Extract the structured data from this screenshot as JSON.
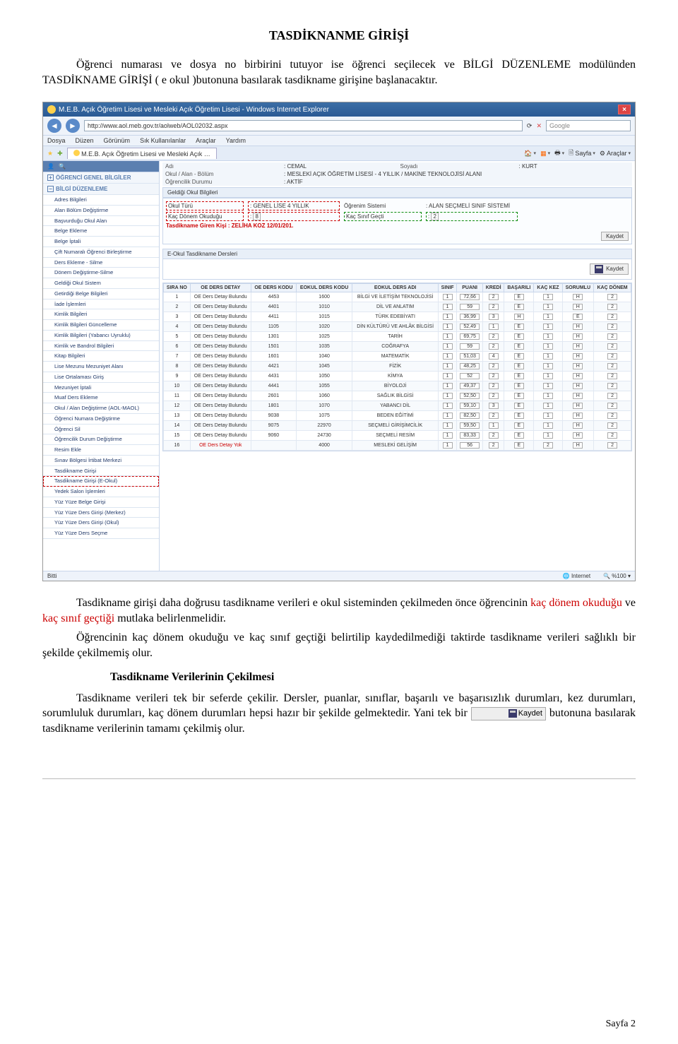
{
  "doc": {
    "title": "TASDİKNANME GİRİŞİ",
    "para1a": "Öğrenci numarası ve dosya no birbirini tutuyor ise öğrenci seçilecek ve BİLGİ DÜZENLEME modülünden TASDİKNAME GİRİŞİ ( e okul )butonuna basılarak tasdikname girişine başlanacaktır.",
    "para2a": "Tasdikname girişi daha doğrusu tasdikname verileri e okul sisteminden çekilmeden önce öğrencinin ",
    "para2b": "kaç dönem okuduğu",
    "para2c": " ve ",
    "para2d": "kaç sınıf geçtiği",
    "para2e": " mutlaka belirlenmelidir.",
    "para3": "Öğrencinin kaç dönem okuduğu ve kaç sınıf geçtiği belirtilip kaydedilmediği taktirde tasdikname verileri sağlıklı bir şekilde çekilmemiş olur.",
    "subheading": "Tasdikname Verilerinin Çekilmesi",
    "para4a": "Tasdikname verileri tek bir seferde çekilir. Dersler, puanlar, sınıflar, başarılı ve başarısızlık durumları, kez durumları, sorumluluk durumları, kaç dönem durumları hepsi hazır bir şekilde gelmektedir. Yani tek bir ",
    "para4b": "butonuna basılarak tasdikname verilerinin tamamı çekilmiş olur.",
    "kaydet": "Kaydet",
    "page": "Sayfa 2"
  },
  "ie": {
    "title": "M.E.B. Açık Öğretim Lisesi ve Mesleki Açık Öğretim Lisesi - Windows Internet Explorer",
    "url": "http://www.aol.meb.gov.tr/aolweb/AOL02032.aspx",
    "search": "Google",
    "menus": [
      "Dosya",
      "Düzen",
      "Görünüm",
      "Sık Kullanılanlar",
      "Araçlar",
      "Yardım"
    ],
    "tab": "M.E.B. Açık Öğretim Lisesi ve Mesleki Açık …",
    "tb": {
      "sayfa": "Sayfa",
      "araclar": "Araçlar"
    },
    "status_left": "Bitti",
    "status_net": "Internet",
    "status_zoom": "%100"
  },
  "sidebar": {
    "sections": [
      {
        "label": "ÖĞRENCİ GENEL BİLGİLER",
        "collapsed": true
      },
      {
        "label": "BİLGİ DÜZENLEME",
        "collapsed": false
      }
    ],
    "items": [
      "Adres Bilgileri",
      "Alan Bölüm Değiştirme",
      "Başvurduğu Okul Alan",
      "Belge Ekleme",
      "Belge İptali",
      "Çift Numaralı Öğrenci Birleştirme",
      "Ders Ekleme - Silme",
      "Dönem Değiştirme-Silme",
      "Geldiği Okul Sistem",
      "Getirdiği Belge Bilgileri",
      "İade İşlemleri",
      "Kimlik Bilgileri",
      "Kimlik Bilgileri Güncelleme",
      "Kimlik Bilgileri (Yabancı Uyruklu)",
      "Kimlik ve Bandrol Bilgileri",
      "Kitap Bilgileri",
      "Lise Mezunu Mezuniyet Alanı",
      "Lise Ortalaması Giriş",
      "Mezuniyet İptali",
      "Muaf Ders Ekleme",
      "Okul / Alan Değiştirme (AOL-MAOL)",
      "Öğrenci Numara Değiştirme",
      "Öğrenci Sil",
      "Öğrencilik Durum Değiştirme",
      "Resim Ekle",
      "Sınav Bölgesi İrtibat Merkezi",
      "Tasdikname Girişi",
      "Tasdikname Girişi (E-Okul)",
      "Yedek Salon İşlemleri",
      "Yüz Yüze Belge Girişi",
      "Yüz Yüze Ders Girişi (Merkez)",
      "Yüz Yüze Ders Girişi (Okul)",
      "Yüz Yüze Ders Seçme"
    ]
  },
  "main": {
    "info": {
      "adi_label": "Adı",
      "adi_value": ": CEMAL",
      "soyadi_label": "Soyadı",
      "soyadi_value": ": KURT",
      "okul_label": "Okul / Alan - Bölüm",
      "okul_value": ": MESLEKİ AÇIK ÖĞRETİM LİSESİ - 4 YILLIK / MAKİNE TEKNOLOJİSİ ALANI",
      "durum_label": "Öğrencilik Durumu",
      "durum_value": ": AKTİF"
    },
    "geldigi_title": "Geldiği Okul Bilgileri",
    "geldigi": {
      "okul_turu_label": "Okul Türü",
      "okul_turu_value": ": GENEL LİSE 4 YILLIK",
      "ogrenim_label": "Öğrenim Sistemi",
      "ogrenim_value": ": ALAN SEÇMELİ SINIF SİSTEMİ",
      "kac_donem_label": "Kaç Dönem Okuduğu",
      "kac_donem_value": "8",
      "kac_sinif_label": "Kaç Sınıf Geçti",
      "kac_sinif_value": "2",
      "giren_kisi": "Tasdikname Giren Kişi : ZELİHA KOZ 12/01/201.",
      "kaydet_btn": "Kaydet"
    },
    "eokul_title": "E-Okul Tasdikname Dersleri",
    "kaydet_btn2": "Kaydet",
    "headers": [
      "SIRA NO",
      "OE DERS DETAY",
      "OE DERS KODU",
      "EOKUL DERS KODU",
      "EOKUL DERS ADI",
      "SINIF",
      "PUANI",
      "KREDİ",
      "BAŞARILI",
      "KAÇ KEZ",
      "SORUMLU",
      "KAÇ DÖNEM"
    ],
    "rows": [
      {
        "no": "1",
        "detay": "OE Ders Detay Bulundu",
        "oekod": "4453",
        "ekod": "1600",
        "ad": "BİLGİ VE İLETİŞİM TEKNOLOJİSİ",
        "sinif": "1",
        "puan": "72,66",
        "kredi": "2",
        "bas": "E",
        "kez": "1",
        "sor": "H",
        "don": "2"
      },
      {
        "no": "2",
        "detay": "OE Ders Detay Bulundu",
        "oekod": "4401",
        "ekod": "1010",
        "ad": "DİL VE ANLATIM",
        "sinif": "1",
        "puan": "59",
        "kredi": "2",
        "bas": "E",
        "kez": "1",
        "sor": "H",
        "don": "2"
      },
      {
        "no": "3",
        "detay": "OE Ders Detay Bulundu",
        "oekod": "4411",
        "ekod": "1015",
        "ad": "TÜRK EDEBİYATI",
        "sinif": "1",
        "puan": "36,99",
        "kredi": "3",
        "bas": "H",
        "kez": "1",
        "sor": "E",
        "don": "2"
      },
      {
        "no": "4",
        "detay": "OE Ders Detay Bulundu",
        "oekod": "1105",
        "ekod": "1020",
        "ad": "DİN KÜLTÜRÜ VE AHLÂK BİLGİSİ",
        "sinif": "1",
        "puan": "52,49",
        "kredi": "1",
        "bas": "E",
        "kez": "1",
        "sor": "H",
        "don": "2"
      },
      {
        "no": "5",
        "detay": "OE Ders Detay Bulundu",
        "oekod": "1301",
        "ekod": "1025",
        "ad": "TARİH",
        "sinif": "1",
        "puan": "69,75",
        "kredi": "2",
        "bas": "E",
        "kez": "1",
        "sor": "H",
        "don": "2"
      },
      {
        "no": "6",
        "detay": "OE Ders Detay Bulundu",
        "oekod": "1501",
        "ekod": "1035",
        "ad": "COĞRAFYA",
        "sinif": "1",
        "puan": "59",
        "kredi": "2",
        "bas": "E",
        "kez": "1",
        "sor": "H",
        "don": "2"
      },
      {
        "no": "7",
        "detay": "OE Ders Detay Bulundu",
        "oekod": "1601",
        "ekod": "1040",
        "ad": "MATEMATİK",
        "sinif": "1",
        "puan": "51,03",
        "kredi": "4",
        "bas": "E",
        "kez": "1",
        "sor": "H",
        "don": "2"
      },
      {
        "no": "8",
        "detay": "OE Ders Detay Bulundu",
        "oekod": "4421",
        "ekod": "1045",
        "ad": "FİZİK",
        "sinif": "1",
        "puan": "48,25",
        "kredi": "2",
        "bas": "E",
        "kez": "1",
        "sor": "H",
        "don": "2"
      },
      {
        "no": "9",
        "detay": "OE Ders Detay Bulundu",
        "oekod": "4431",
        "ekod": "1050",
        "ad": "KİMYA",
        "sinif": "1",
        "puan": "52",
        "kredi": "2",
        "bas": "E",
        "kez": "1",
        "sor": "H",
        "don": "2"
      },
      {
        "no": "10",
        "detay": "OE Ders Detay Bulundu",
        "oekod": "4441",
        "ekod": "1055",
        "ad": "BİYOLOJİ",
        "sinif": "1",
        "puan": "49,37",
        "kredi": "2",
        "bas": "E",
        "kez": "1",
        "sor": "H",
        "don": "2"
      },
      {
        "no": "11",
        "detay": "OE Ders Detay Bulundu",
        "oekod": "2601",
        "ekod": "1060",
        "ad": "SAĞLIK BİLGİSİ",
        "sinif": "1",
        "puan": "52,50",
        "kredi": "2",
        "bas": "E",
        "kez": "1",
        "sor": "H",
        "don": "2"
      },
      {
        "no": "12",
        "detay": "OE Ders Detay Bulundu",
        "oekod": "1801",
        "ekod": "1070",
        "ad": "YABANCI DİL",
        "sinif": "1",
        "puan": "59,10",
        "kredi": "3",
        "bas": "E",
        "kez": "1",
        "sor": "H",
        "don": "2"
      },
      {
        "no": "13",
        "detay": "OE Ders Detay Bulundu",
        "oekod": "9038",
        "ekod": "1075",
        "ad": "BEDEN EĞİTİMİ",
        "sinif": "1",
        "puan": "82,50",
        "kredi": "2",
        "bas": "E",
        "kez": "1",
        "sor": "H",
        "don": "2"
      },
      {
        "no": "14",
        "detay": "OE Ders Detay Bulundu",
        "oekod": "9075",
        "ekod": "22970",
        "ad": "SEÇMELİ GİRİŞİMCİLİK",
        "sinif": "1",
        "puan": "59,50",
        "kredi": "1",
        "bas": "E",
        "kez": "1",
        "sor": "H",
        "don": "2"
      },
      {
        "no": "15",
        "detay": "OE Ders Detay Bulundu",
        "oekod": "9060",
        "ekod": "24730",
        "ad": "SEÇMELİ RESİM",
        "sinif": "1",
        "puan": "83,33",
        "kredi": "2",
        "bas": "E",
        "kez": "1",
        "sor": "H",
        "don": "2"
      },
      {
        "no": "16",
        "detay": "OE Ders Detay Yok",
        "oekod": "",
        "ekod": "4000",
        "ad": "MESLEKİ GELİŞİM",
        "sinif": "1",
        "puan": "56",
        "kredi": "2",
        "bas": "E",
        "kez": "2",
        "sor": "H",
        "don": "2"
      }
    ]
  }
}
